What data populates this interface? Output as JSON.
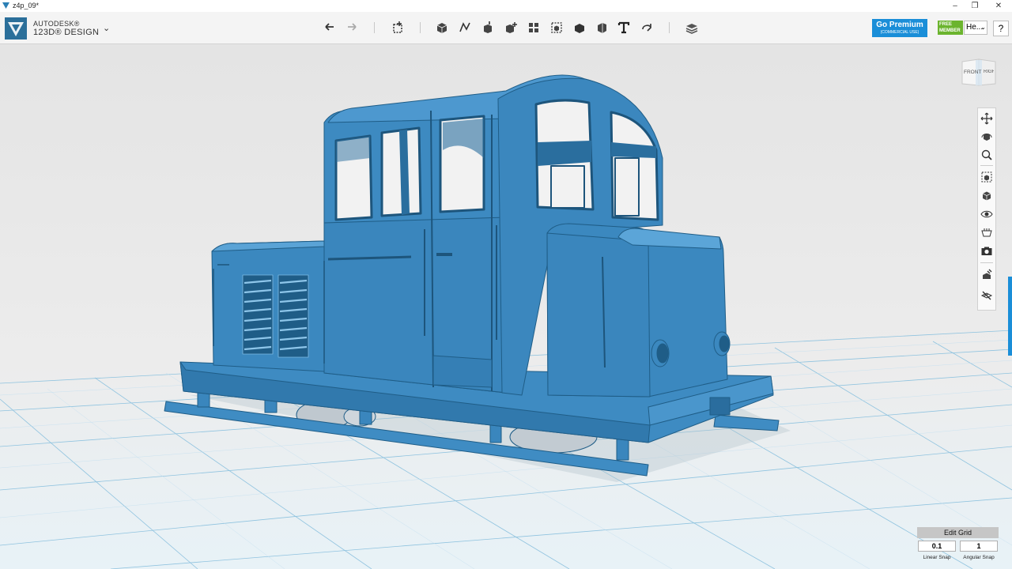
{
  "window": {
    "title": "z4p_09*",
    "minimize": "–",
    "maximize": "❐",
    "close": "✕"
  },
  "brand": {
    "line1": "AUTODESK®",
    "line2": "123D® DESIGN",
    "menu": "⌄"
  },
  "toolbar": {
    "tools": [
      "undo-icon",
      "redo-icon",
      "transform-icon",
      "primitives-icon",
      "sketch-icon",
      "construct-icon",
      "modify-icon",
      "pattern-icon",
      "grouping-icon",
      "combine-icon",
      "measure-icon",
      "text-icon",
      "snap-icon",
      "material-icon"
    ]
  },
  "premium": {
    "title": "Go Premium",
    "subtitle": "(COMMERCIAL USE)"
  },
  "member": {
    "badge_line1": "FREE",
    "badge_line2": "MEMBER",
    "user": "He...",
    "help": "?"
  },
  "viewcube": {
    "front": "FRONT",
    "right": "RIGHT"
  },
  "nav_tools": [
    "pan-icon",
    "orbit-icon",
    "zoom-icon",
    "fit-icon",
    "views-icon",
    "visibility-icon",
    "materials-icon",
    "camera-icon",
    "outlines-icon",
    "grid-icon"
  ],
  "grid_panel": {
    "title": "Edit Grid",
    "linear_value": "0.1",
    "angular_value": "1",
    "linear_label": "Linear Snap",
    "angular_label": "Angular Snap"
  },
  "colors": {
    "model": "#3a88bf",
    "grid_line": "#8fc3df",
    "accent": "#1a8ed8"
  }
}
